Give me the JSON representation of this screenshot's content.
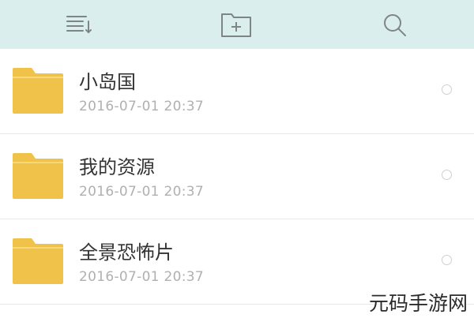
{
  "toolbar": {
    "icons": [
      "sort-list-icon",
      "new-folder-icon",
      "search-icon"
    ]
  },
  "colors": {
    "toolbar_bg": "#dbeeee",
    "folder": "#f0c24a",
    "icon_stroke": "#7f8585"
  },
  "folders": [
    {
      "name": "小岛国",
      "date": "2016-07-01  20:37"
    },
    {
      "name": "我的资源",
      "date": "2016-07-01  20:37"
    },
    {
      "name": "全景恐怖片",
      "date": "2016-07-01  20:37"
    }
  ],
  "watermark": "元码手游网"
}
